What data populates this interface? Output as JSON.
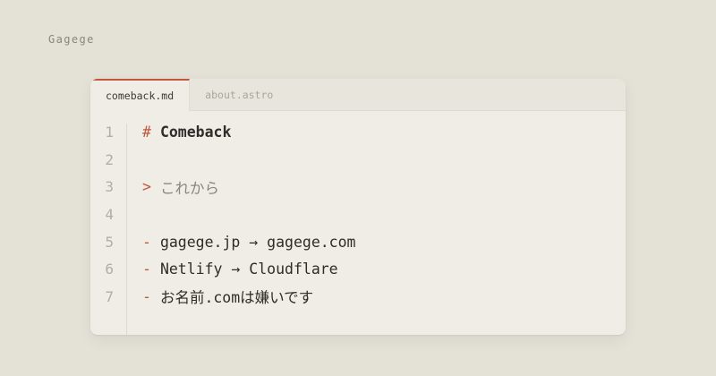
{
  "brand": "Gagege",
  "tabs": [
    {
      "label": "comeback.md",
      "active": true
    },
    {
      "label": "about.astro",
      "active": false
    }
  ],
  "lines": [
    {
      "number": "1",
      "marker": "#",
      "text": "Comeback"
    },
    {
      "number": "2",
      "marker": "",
      "text": ""
    },
    {
      "number": "3",
      "marker": ">",
      "text": "これから"
    },
    {
      "number": "4",
      "marker": "",
      "text": ""
    },
    {
      "number": "5",
      "marker": "-",
      "text": "gagege.jp → gagege.com"
    },
    {
      "number": "6",
      "marker": "-",
      "text": "Netlify → Cloudflare"
    },
    {
      "number": "7",
      "marker": "-",
      "text": "お名前.comは嫌いです"
    }
  ],
  "colors": {
    "background": "#e4e1d6",
    "editor": "#efede6",
    "accent": "#c0573a"
  }
}
